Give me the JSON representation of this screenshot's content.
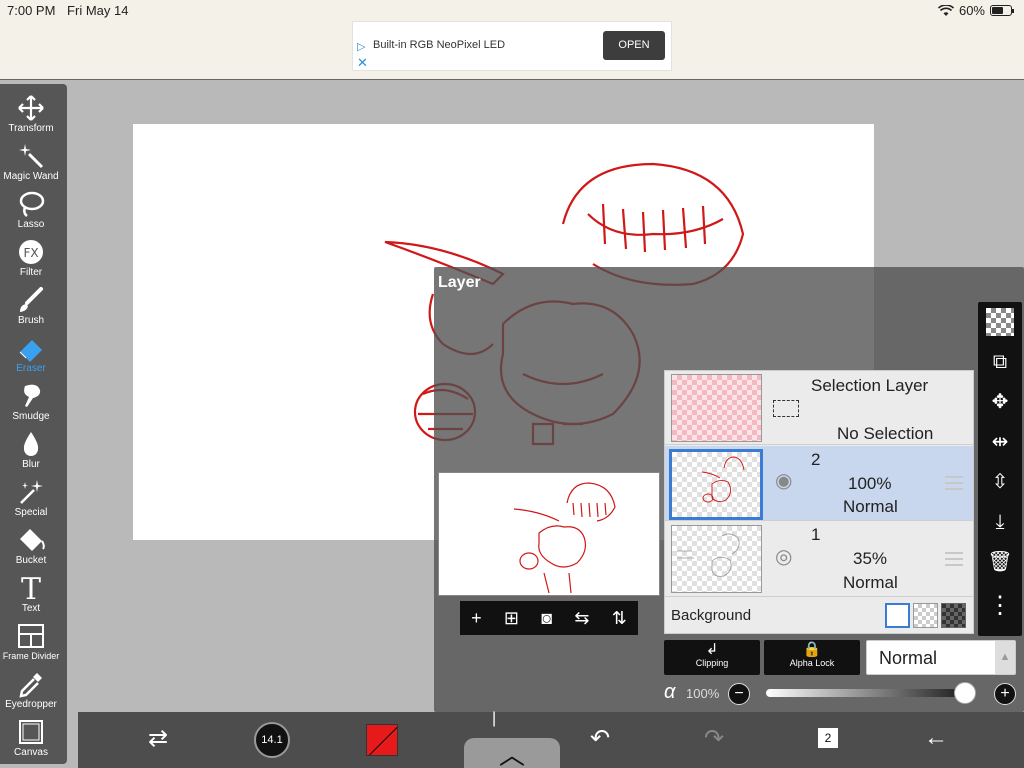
{
  "status": {
    "time": "7:00 PM",
    "date": "Fri May 14",
    "battery": "60%"
  },
  "ad": {
    "text": "Built-in RGB NeoPixel LED",
    "button": "OPEN"
  },
  "toolbar": {
    "items": [
      {
        "label": "Transform",
        "icon": "move-arrows-icon"
      },
      {
        "label": "Magic Wand",
        "icon": "magic-wand-icon"
      },
      {
        "label": "Lasso",
        "icon": "lasso-icon"
      },
      {
        "label": "Filter",
        "icon": "fx-icon"
      },
      {
        "label": "Brush",
        "icon": "brush-icon"
      },
      {
        "label": "Eraser",
        "icon": "eraser-icon",
        "active": true
      },
      {
        "label": "Smudge",
        "icon": "smudge-icon"
      },
      {
        "label": "Blur",
        "icon": "drop-icon"
      },
      {
        "label": "Special",
        "icon": "sparkle-icon"
      },
      {
        "label": "Bucket",
        "icon": "bucket-icon"
      },
      {
        "label": "Text",
        "icon": "text-icon"
      },
      {
        "label": "Frame Divider",
        "icon": "frame-divider-icon"
      },
      {
        "label": "Eyedropper",
        "icon": "eyedropper-icon"
      },
      {
        "label": "Canvas",
        "icon": "canvas-icon"
      }
    ]
  },
  "layer_panel": {
    "title": "Layer",
    "selection_layer": {
      "name": "Selection Layer",
      "status": "No Selection"
    },
    "layers": [
      {
        "number": "2",
        "opacity": "100%",
        "mode": "Normal",
        "selected": true
      },
      {
        "number": "1",
        "opacity": "35%",
        "mode": "Normal",
        "selected": false
      }
    ],
    "background_label": "Background",
    "clipping_label": "Clipping",
    "alpha_lock_label": "Alpha Lock",
    "blend_mode": "Normal",
    "alpha_symbol": "α",
    "opacity_value": "100%",
    "opacity_fraction": 1.0
  },
  "bottom_bar": {
    "brush_size": "14.1",
    "layer_count": "2",
    "brush_color": "#e61a1a"
  }
}
